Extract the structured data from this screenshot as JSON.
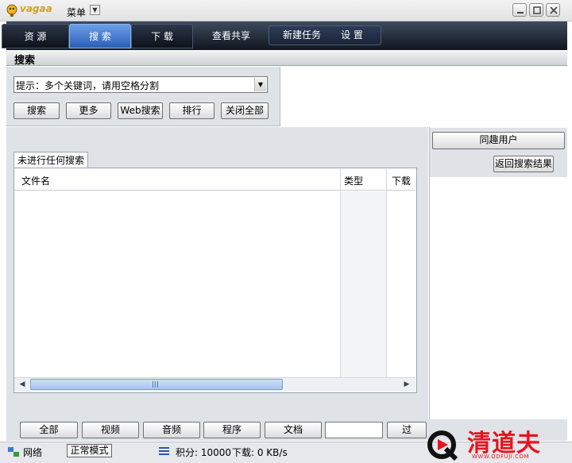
{
  "app": {
    "logo_text": "vagaa",
    "menu_label": "菜单"
  },
  "nav": {
    "tabs": [
      "资 源",
      "搜 索",
      "下 载",
      "查看共享",
      "新建任务",
      "设 置"
    ],
    "active": "搜 索"
  },
  "section_title": "搜索",
  "search": {
    "input_value": "提示：多个关键词，请用空格分割",
    "buttons": [
      "搜索",
      "更多",
      "Web搜索",
      "排行",
      "关闭全部"
    ]
  },
  "results": {
    "tab_label": "未进行任何搜索",
    "columns": [
      "文件名",
      "类型",
      "下载"
    ]
  },
  "users_panel": {
    "same_users_label": "同趣用户",
    "return_label": "返回搜索结果"
  },
  "filters": [
    "全部",
    "视频",
    "音频",
    "程序",
    "文档",
    "过"
  ],
  "filter_input_value": "",
  "status": {
    "network": "网络",
    "mode": "正常模式",
    "points": "积分: 10000",
    "download": "下载: 0 KB/s"
  },
  "watermark": {
    "brand": "清道夫",
    "url": "WWW.QDFUJI.COM"
  }
}
